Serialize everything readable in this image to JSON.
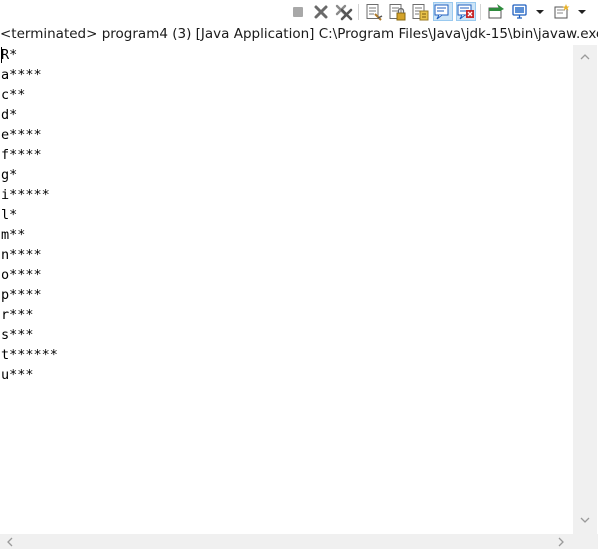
{
  "toolbar": {
    "buttons": [
      {
        "name": "terminate-button",
        "icon": "stop-square-icon",
        "enabled": false
      },
      {
        "name": "remove-launch-button",
        "icon": "remove-x-icon",
        "enabled": true
      },
      {
        "name": "remove-all-terminated-button",
        "icon": "remove-all-x-icon",
        "enabled": true
      },
      {
        "name": "clear-console-button",
        "icon": "clear-console-icon",
        "enabled": true
      },
      {
        "name": "scroll-lock-button",
        "icon": "scroll-lock-icon",
        "enabled": true
      },
      {
        "name": "word-wrap-button",
        "icon": "word-wrap-icon",
        "enabled": true
      },
      {
        "name": "show-console-on-stdout-button",
        "icon": "show-stdout-icon",
        "active": true
      },
      {
        "name": "show-console-on-stderr-button",
        "icon": "show-stderr-icon",
        "active": true
      },
      {
        "name": "pin-console-button",
        "icon": "pin-console-icon",
        "enabled": true
      },
      {
        "name": "display-selected-console-button",
        "icon": "monitor-icon",
        "has_dropdown": true
      },
      {
        "name": "open-console-button",
        "icon": "new-console-icon",
        "has_dropdown": true
      }
    ],
    "colors": {
      "active_bg": "#cce4f7",
      "active_border": "#99c9ef",
      "grey_icon": "#8c8c8c",
      "dark_icon": "#505050",
      "green_accent": "#2e8b3d",
      "blue_accent": "#1f5fbf",
      "red_accent": "#c8292b"
    }
  },
  "status": {
    "text": "<terminated> program4 (3) [Java Application] C:\\Program Files\\Java\\jdk-15\\bin\\javaw.exe"
  },
  "console": {
    "lines": [
      "R*",
      "a****",
      "c**",
      "d*",
      "e****",
      "f****",
      "g*",
      "i*****",
      "l*",
      "m**",
      "n****",
      "o****",
      "p****",
      "r***",
      "s***",
      "t******",
      "u***"
    ]
  },
  "scrollbars": {
    "color": "#f0f0f0",
    "arrow_color": "#a0a0a0"
  }
}
